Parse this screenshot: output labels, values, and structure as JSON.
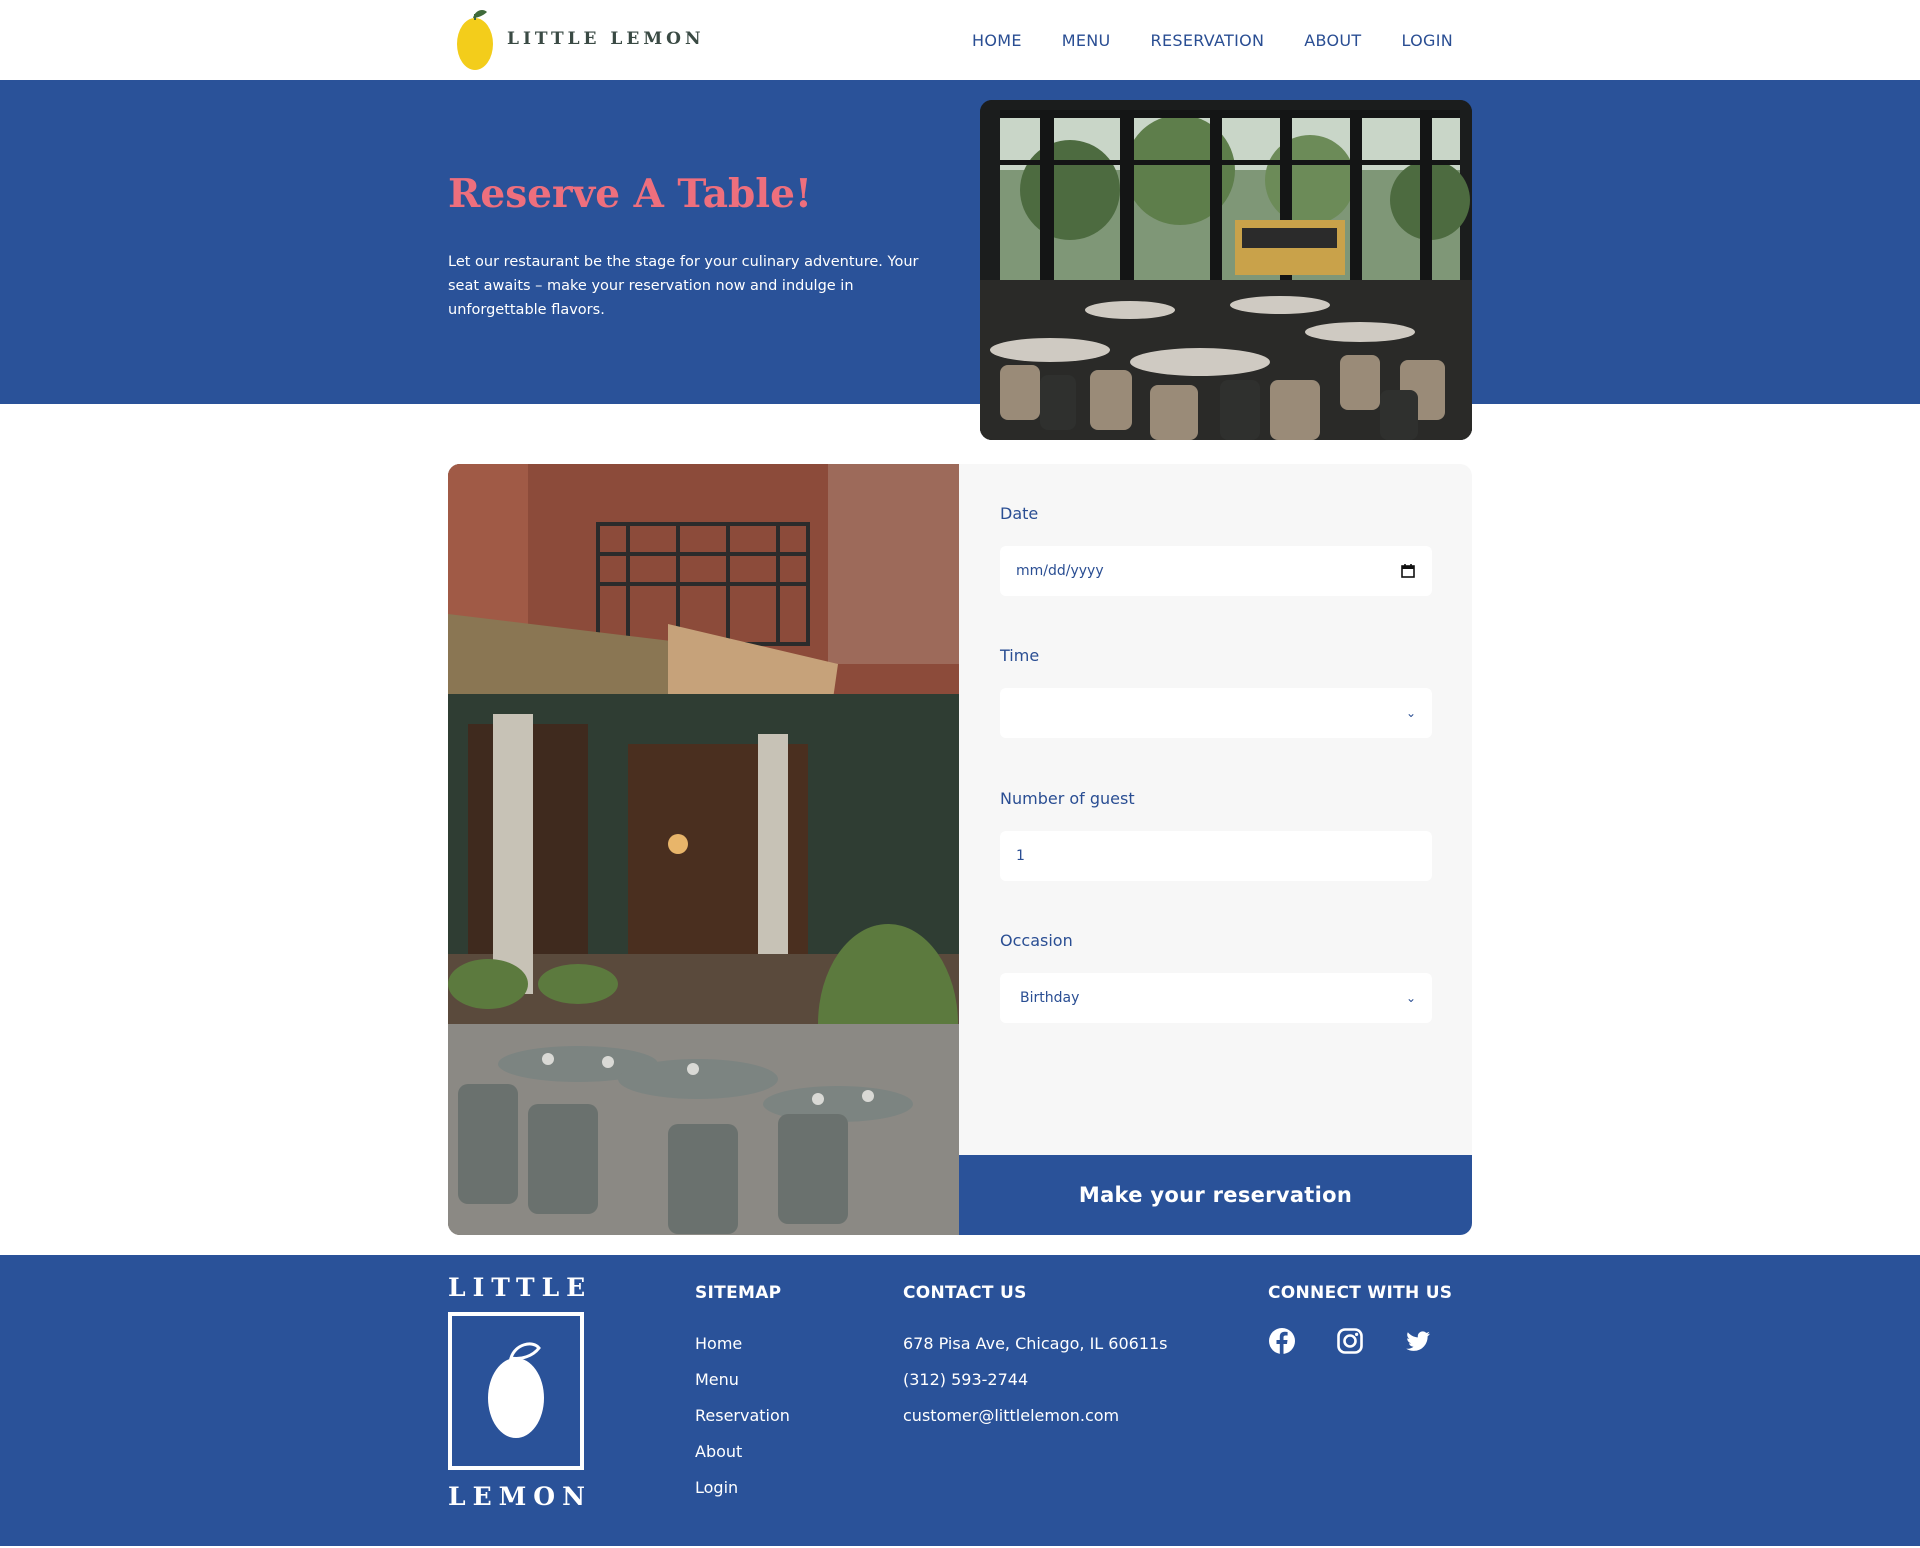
{
  "header": {
    "brand": "LITTLE LEMON",
    "nav": [
      {
        "label": "HOME"
      },
      {
        "label": "MENU"
      },
      {
        "label": "RESERVATION"
      },
      {
        "label": "ABOUT"
      },
      {
        "label": "LOGIN"
      }
    ]
  },
  "hero": {
    "title": "Reserve A Table!",
    "description": "Let our restaurant be the stage for your culinary adventure. Your seat awaits – make your reservation now and indulge in unforgettable flavors."
  },
  "form": {
    "date_label": "Date",
    "date_placeholder": "mm/dd/yyyy",
    "time_label": "Time",
    "time_value": "",
    "guests_label": "Number of guest",
    "guests_value": "1",
    "occasion_label": "Occasion",
    "occasion_value": "Birthday",
    "submit_label": "Make your reservation"
  },
  "footer": {
    "logo_top": "LITTLE",
    "logo_bottom": "LEMON",
    "sitemap_title": "SITEMAP",
    "sitemap": [
      "Home",
      "Menu",
      "Reservation",
      "About",
      "Login"
    ],
    "contact_title": "CONTACT US",
    "contact": [
      "678 Pisa Ave, Chicago, IL 60611s",
      "(312) 593-2744",
      "customer@littlelemon.com"
    ],
    "connect_title": "CONNECT WITH US",
    "social_icons": [
      "facebook-icon",
      "instagram-icon",
      "twitter-icon"
    ]
  },
  "colors": {
    "primary_blue": "#2a5299",
    "accent_pink": "#ee6f7d",
    "lemon_yellow": "#f3cd1b",
    "form_bg": "#f7f7f7"
  }
}
